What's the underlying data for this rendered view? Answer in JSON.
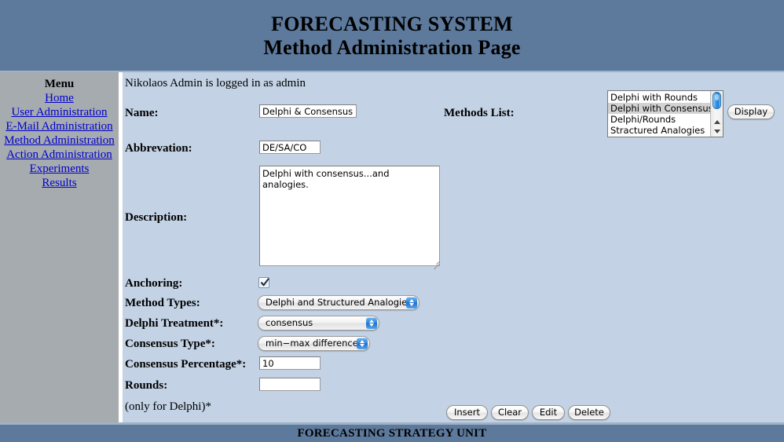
{
  "header": {
    "title_line1": "FORECASTING SYSTEM",
    "title_line2": "Method Administration Page",
    "bg_color": "#5d7a9c"
  },
  "sidebar": {
    "title": "Menu",
    "bg_color": "#a5abae",
    "link_color": "#0000cc",
    "items": [
      {
        "label": "Home"
      },
      {
        "label": "User Administration "
      },
      {
        "label": "E-Mail Administration "
      },
      {
        "label": "Method Administration "
      },
      {
        "label": "Action Administration "
      },
      {
        "label": "Experiments "
      },
      {
        "label": "Results "
      }
    ]
  },
  "main": {
    "bg_color": "#c3d2e4",
    "status_text": "Nikolaos Admin is logged in as admin",
    "labels": {
      "name": "Name:",
      "abbrevation": "Abbrevation:",
      "description": "Description:",
      "anchoring": "Anchoring:",
      "method_types": "Method Types:",
      "delphi_treatment": "Delphi Treatment*:",
      "consensus_type": "Consensus Type*:",
      "consensus_percentage": "Consensus Percentage*:",
      "rounds": "Rounds:",
      "only_for_delphi": "(only for Delphi)*",
      "methods_list": "Methods List:"
    },
    "fields": {
      "name_value": "Delphi & Consensus",
      "abbrevation_value": "DE/SA/CO",
      "description_value": "Delphi with consensus...and analogies.",
      "anchoring_checked": true,
      "method_types_value": "Delphi and Structured Analogies",
      "delphi_treatment_value": "consensus",
      "consensus_type_value": "min−max difference",
      "consensus_percentage_value": "10",
      "rounds_value": ""
    },
    "methods_list": {
      "options": [
        "Delphi with Rounds",
        "Delphi with Consensus",
        "Delphi/Rounds",
        "Stractured Analogies"
      ],
      "selected": "Delphi with Consensus",
      "selected_index": 1
    },
    "buttons": {
      "display": "Display",
      "insert": "Insert",
      "clear": "Clear",
      "edit": "Edit",
      "delete": "Delete"
    }
  },
  "footer": {
    "text": "FORECASTING STRATEGY UNIT",
    "bg_color": "#5d7a9c"
  }
}
